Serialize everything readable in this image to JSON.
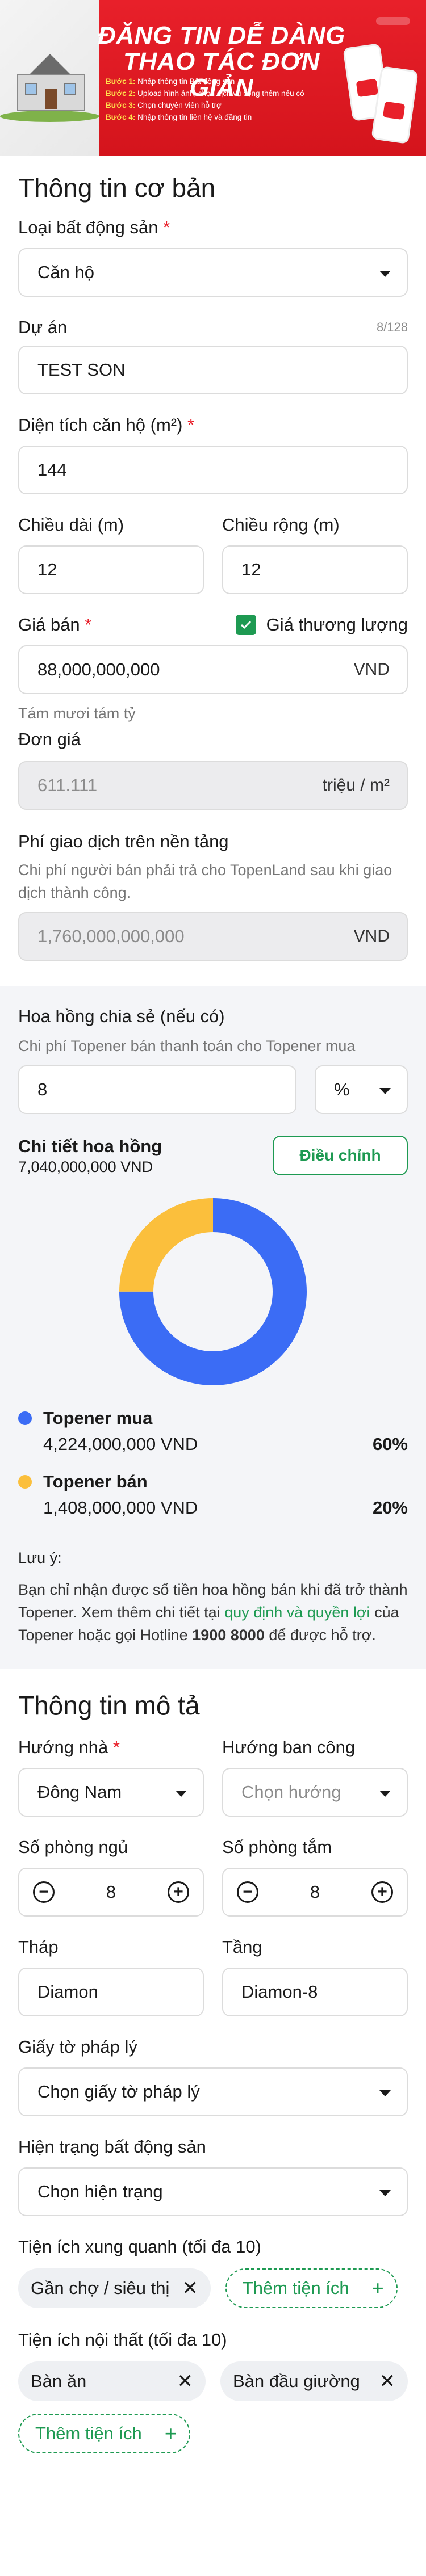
{
  "banner": {
    "title_line1": "ĐĂNG TIN DỄ DÀNG",
    "title_line2": "THAO TÁC ĐƠN GIẢN",
    "steps": [
      {
        "num": "Bước 1:",
        "text": " Nhập thông tin Bất động sản"
      },
      {
        "num": "Bước 2:",
        "text": " Upload hình ảnh, chọn dịch vụ cộng thêm nếu có"
      },
      {
        "num": "Bước 3:",
        "text": " Chọn chuyên viên hỗ trợ"
      },
      {
        "num": "Bước 4:",
        "text": " Nhập thông tin liên hệ và đăng tin"
      }
    ]
  },
  "basic": {
    "heading": "Thông tin cơ bản",
    "property_type_label": "Loại bất động sản",
    "property_type_value": "Căn hộ",
    "project_label": "Dự án",
    "project_counter": "8/128",
    "project_value": "TEST SON",
    "area_label": "Diện tích căn hộ (m²)",
    "area_value": "144",
    "length_label": "Chiều dài (m)",
    "length_value": "12",
    "width_label": "Chiều rộng (m)",
    "width_value": "12",
    "price_label": "Giá bán",
    "negotiable_label": "Giá thương lượng",
    "negotiable_checked": true,
    "price_value": "88,000,000,000",
    "price_unit": "VND",
    "price_in_words": "Tám mươi tám tỷ",
    "unit_price_label": "Đơn giá",
    "unit_price_value": "611.111",
    "unit_price_unit": "triệu / m²",
    "fee_label": "Phí giao dịch trên nền tảng",
    "fee_desc": "Chi phí người bán phải trả cho TopenLand sau khi giao dịch thành công.",
    "fee_value": "1,760,000,000,000",
    "fee_unit": "VND"
  },
  "commission": {
    "label": "Hoa hồng chia sẻ (nếu có)",
    "desc": "Chi phí Topener bán thanh toán cho Topener mua",
    "value": "8",
    "unit_select": "%",
    "detail_label": "Chi tiết hoa hồng",
    "detail_total": "7,040,000,000 VND",
    "adjust_button": "Điều chỉnh",
    "legend": [
      {
        "name": "Topener mua",
        "amount": "4,224,000,000 VND",
        "percent": "60%",
        "color": "#3b6cf5",
        "value": 60
      },
      {
        "name": "Topener bán",
        "amount": "1,408,000,000 VND",
        "percent": "20%",
        "color": "#fbbf3c",
        "value": 20
      }
    ],
    "note_title": "Lưu ý:",
    "note_part1": "Bạn chỉ nhận được số tiền hoa hồng bán khi đã trở thành Topener. Xem thêm chi tiết tại ",
    "note_link": "quy định và quyền lợi",
    "note_part2": " của Topener hoặc gọi Hotline ",
    "note_hotline": "1900 8000",
    "note_part3": " để được hỗ trợ."
  },
  "description": {
    "heading": "Thông tin mô tả",
    "direction_label": "Hướng nhà",
    "direction_value": "Đông Nam",
    "balcony_label": "Hướng ban công",
    "balcony_placeholder": "Chọn hướng",
    "bedrooms_label": "Số phòng ngủ",
    "bedrooms_value": "8",
    "bathrooms_label": "Số phòng tắm",
    "bathrooms_value": "8",
    "tower_label": "Tháp",
    "tower_value": "Diamon",
    "floor_label": "Tầng",
    "floor_value": "Diamon-8",
    "legal_label": "Giấy tờ pháp lý",
    "legal_placeholder": "Chọn giấy tờ pháp lý",
    "status_label": "Hiện trạng bất động sản",
    "status_placeholder": "Chọn hiện trạng",
    "nearby_label": "Tiện ích xung quanh (tối đa 10)",
    "nearby_chips": [
      "Gần chợ / siêu thị"
    ],
    "add_label": "Thêm tiện ích",
    "interior_label": "Tiện ích nội thất (tối đa 10)",
    "interior_chips": [
      "Bàn ăn",
      "Bàn đầu giường"
    ]
  },
  "colors": {
    "brand_red": "#e8202a",
    "accent_green": "#1e9a52",
    "buyer_blue": "#3b6cf5",
    "seller_yellow": "#fbbf3c"
  }
}
